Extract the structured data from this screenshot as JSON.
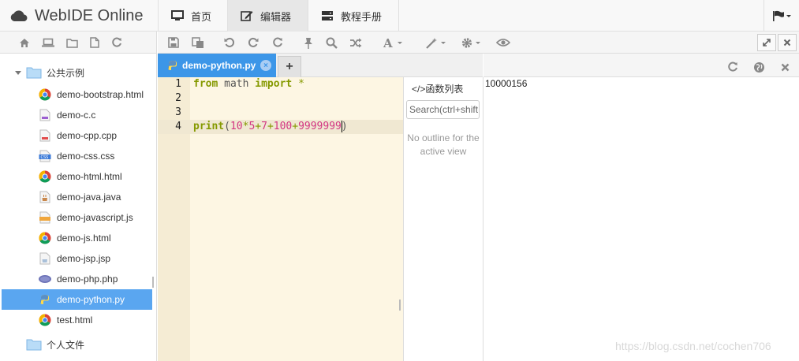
{
  "app": {
    "title": "WebIDE Online",
    "cloud_icon": "cloud-icon"
  },
  "nav": {
    "tabs": [
      {
        "label": "首页",
        "icon": "desktop-icon"
      },
      {
        "label": "编辑器",
        "icon": "edit-icon",
        "active": true
      },
      {
        "label": "教程手册",
        "icon": "server-icon"
      }
    ],
    "flag_icon": "flag-icon"
  },
  "sidebar": {
    "toolbar_icons": [
      "home-icon",
      "laptop-icon",
      "folder-icon",
      "file-icon",
      "refresh-icon"
    ],
    "tree": {
      "root": "公共示例",
      "files": [
        {
          "name": "demo-bootstrap.html",
          "icon": "chrome-icon"
        },
        {
          "name": "demo-c.c",
          "icon": "c-file-icon"
        },
        {
          "name": "demo-cpp.cpp",
          "icon": "cpp-file-icon"
        },
        {
          "name": "demo-css.css",
          "icon": "css-file-icon"
        },
        {
          "name": "demo-html.html",
          "icon": "chrome-icon"
        },
        {
          "name": "demo-java.java",
          "icon": "java-file-icon"
        },
        {
          "name": "demo-javascript.js",
          "icon": "js-file-icon"
        },
        {
          "name": "demo-js.html",
          "icon": "chrome-icon"
        },
        {
          "name": "demo-jsp.jsp",
          "icon": "jsp-file-icon"
        },
        {
          "name": "demo-php.php",
          "icon": "php-file-icon"
        },
        {
          "name": "demo-python.py",
          "icon": "python-icon",
          "selected": true
        },
        {
          "name": "test.html",
          "icon": "chrome-icon"
        }
      ],
      "personal": "个人文件"
    }
  },
  "editor": {
    "toolbar_icons": [
      "save-icon",
      "save-all-icon",
      "undo-icon",
      "redo-icon",
      "refresh-icon",
      "pin-icon",
      "search-icon",
      "shuffle-icon",
      "font-icon",
      "magic-icon",
      "settings-icon",
      "preview-icon"
    ],
    "tab": {
      "label": "demo-python.py",
      "close": "×"
    },
    "add_tab": "+",
    "lines": [
      {
        "no": "1",
        "tokens": [
          {
            "t": "from",
            "c": "kw"
          },
          {
            "t": " math ",
            "c": "plain"
          },
          {
            "t": "import",
            "c": "kw"
          },
          {
            "t": " *",
            "c": "op"
          }
        ]
      },
      {
        "no": "2",
        "tokens": []
      },
      {
        "no": "3",
        "tokens": []
      },
      {
        "no": "4",
        "tokens": [
          {
            "t": "print",
            "c": "kw"
          },
          {
            "t": "(",
            "c": "plain"
          },
          {
            "t": "10",
            "c": "num"
          },
          {
            "t": "*",
            "c": "op"
          },
          {
            "t": "5",
            "c": "num"
          },
          {
            "t": "+",
            "c": "op"
          },
          {
            "t": "7",
            "c": "num"
          },
          {
            "t": "+",
            "c": "op"
          },
          {
            "t": "100",
            "c": "num"
          },
          {
            "t": "+",
            "c": "op"
          },
          {
            "t": "9999999",
            "c": "num"
          },
          {
            "t": ")",
            "c": "plain"
          }
        ]
      }
    ],
    "active_line": 4
  },
  "outline": {
    "title": "</>函数列表",
    "search_placeholder": "Search(ctrl+shift",
    "empty_text": "No outline for the active view"
  },
  "output": {
    "window_icons": [
      "expand-icon",
      "close-icon"
    ],
    "panel_icons": [
      "refresh-icon",
      "globe-icon",
      "close-icon"
    ],
    "text": "10000156"
  },
  "watermark": "https://blog.csdn.net/cochen706",
  "colors": {
    "accent": "#3c96e8",
    "selected": "#5aa6f0",
    "editor_bg": "#fdf6e3",
    "gutter_bg": "#f5ecd4"
  }
}
